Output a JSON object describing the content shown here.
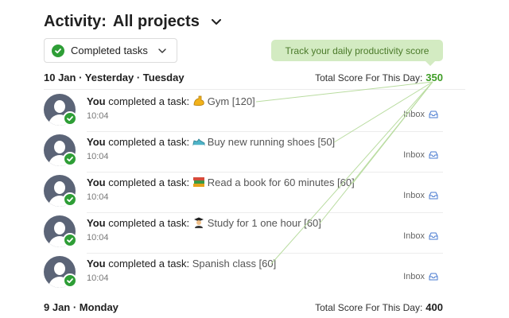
{
  "header": {
    "prefix": "Activity:",
    "project": "All projects",
    "dropdown_icon": "chevron-down-icon"
  },
  "filter": {
    "label": "Completed tasks",
    "icon": "check-circle-icon"
  },
  "tooltip": {
    "text": "Track your daily productivity score"
  },
  "colors": {
    "accent_green": "#2e9e36",
    "score_green": "#3f9d26",
    "tooltip_bg": "#d3ebc2",
    "avatar": "#5b6477"
  },
  "days": [
    {
      "date": "10 Jan · Yesterday · Tuesday",
      "score_label": "Total Score For This Day:",
      "score": "350",
      "items": [
        {
          "user": "You",
          "action": "completed a task:",
          "emoji": "flexed-biceps-icon",
          "task": "Gym [120]",
          "time": "10:04",
          "project": "Inbox"
        },
        {
          "user": "You",
          "action": "completed a task:",
          "emoji": "running-shoe-icon",
          "task": "Buy new running shoes [50]",
          "time": "10:04",
          "project": "Inbox"
        },
        {
          "user": "You",
          "action": "completed a task:",
          "emoji": "books-icon",
          "task": "Read a book for 60 minutes [60]",
          "time": "10:04",
          "project": "Inbox"
        },
        {
          "user": "You",
          "action": "completed a task:",
          "emoji": "student-icon",
          "task": "Study for 1 one hour [60]",
          "time": "10:04",
          "project": "Inbox"
        },
        {
          "user": "You",
          "action": "completed a task:",
          "emoji": "",
          "task": "Spanish class [60]",
          "time": "10:04",
          "project": "Inbox"
        }
      ]
    },
    {
      "date": "9 Jan · Monday",
      "score_label": "Total Score For This Day:",
      "score": "400",
      "items": []
    }
  ]
}
